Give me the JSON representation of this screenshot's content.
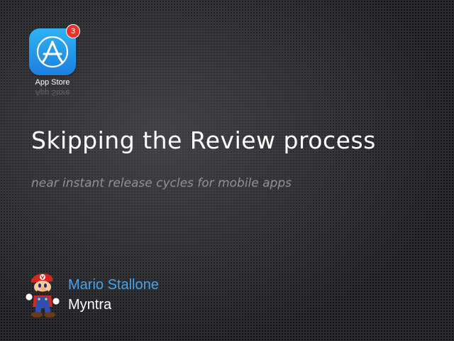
{
  "app_icon": {
    "label": "App Store",
    "badge_count": "3",
    "icon": "app-store-icon",
    "colors": {
      "top": "#2fb3f5",
      "bottom": "#1b7fdf",
      "badge": "#e8332b"
    }
  },
  "slide": {
    "title": "Skipping the Review process",
    "subtitle": "near instant release cycles for mobile apps"
  },
  "presenter": {
    "name": "Mario Stallone",
    "organization": "Myntra",
    "avatar_icon": "mario-character-icon",
    "name_color": "#4aa3e8"
  }
}
